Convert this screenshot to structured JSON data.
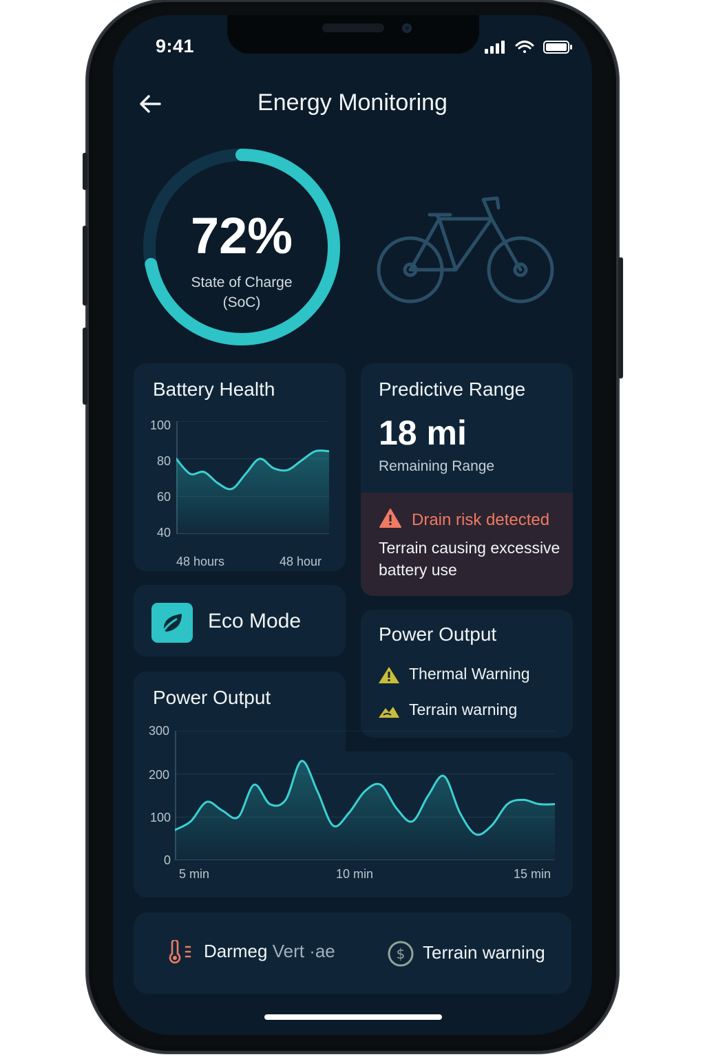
{
  "status_bar": {
    "time": "9:41"
  },
  "header": {
    "title": "Energy Monitoring",
    "back_icon": "arrow-left-icon"
  },
  "soc": {
    "value": "72%",
    "label_line1": "State of Charge",
    "label_line2": "(SoC)",
    "fraction": 0.72,
    "accent": "#2ec3c6"
  },
  "bike_icon": "bicycle-icon",
  "battery_health": {
    "title": "Battery Health",
    "y_ticks": [
      "100",
      "80",
      "60",
      "40"
    ],
    "x_ticks": [
      "48 hours",
      "48 hour"
    ]
  },
  "predictive_range": {
    "title": "Predictive Range",
    "value": "18 mi",
    "subtitle": "Remaining Range",
    "alert": {
      "title": "Drain risk detected",
      "message": "Terrain causing excessive battery use",
      "color": "#f07a62"
    }
  },
  "eco_mode": {
    "label": "Eco Mode",
    "icon": "eco-leaf-icon"
  },
  "power_output_warnings": {
    "title": "Power Output",
    "items": [
      {
        "label": "Thermal Warning",
        "icon": "warning-triangle-icon"
      },
      {
        "label": "Terrain warning",
        "icon": "terrain-icon"
      }
    ]
  },
  "power_output_chart": {
    "title": "Power Output",
    "y_ticks": [
      "300",
      "200",
      "100",
      "0"
    ],
    "x_ticks": [
      "5 min",
      "10 min",
      "15 min"
    ]
  },
  "bottom_bar": {
    "item1": {
      "label_a": "Darmeg",
      "label_b": "Vert ·ae",
      "icon": "thermometer-icon"
    },
    "item2": {
      "label": "Terrain warning",
      "icon": "coin-icon"
    }
  },
  "chart_data": [
    {
      "type": "area",
      "title": "Battery Health",
      "xlabel": "",
      "ylabel": "",
      "ylim": [
        40,
        100
      ],
      "x": [
        0,
        1,
        2,
        3,
        4,
        5,
        6,
        7,
        8,
        9,
        10,
        11
      ],
      "x_tick_labels": [
        "48 hours",
        "48 hour"
      ],
      "series": [
        {
          "values": [
            80,
            72,
            73,
            67,
            64,
            72,
            80,
            75,
            74,
            79,
            84,
            84
          ]
        }
      ]
    },
    {
      "type": "area",
      "title": "Power Output",
      "xlabel": "",
      "ylabel": "",
      "ylim": [
        0,
        300
      ],
      "x_tick_labels": [
        "5 min",
        "10 min",
        "15 min"
      ],
      "x": [
        0,
        1,
        2,
        3,
        4,
        5,
        6,
        7,
        8,
        9,
        10,
        11,
        12,
        13,
        14,
        15,
        16,
        17,
        18,
        19,
        20,
        21,
        22,
        23,
        24
      ],
      "series": [
        {
          "values": [
            70,
            90,
            135,
            115,
            100,
            175,
            130,
            140,
            230,
            160,
            80,
            110,
            160,
            175,
            120,
            90,
            150,
            195,
            110,
            60,
            80,
            130,
            140,
            130,
            130
          ]
        }
      ]
    }
  ]
}
